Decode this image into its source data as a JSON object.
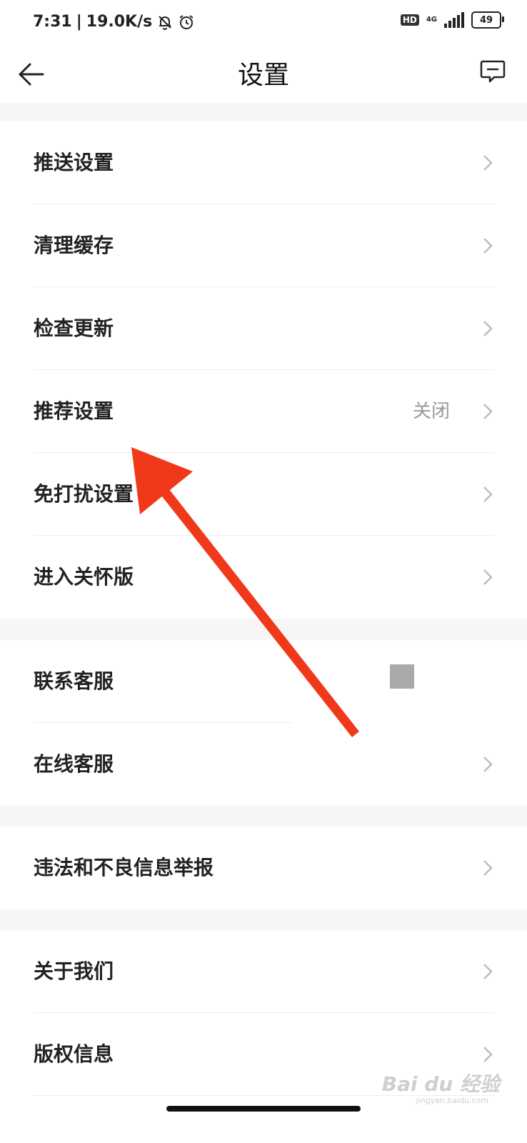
{
  "status": {
    "time": "7:31",
    "speed": "19.0K/s",
    "icons": [
      "bell-mute-icon",
      "alarm-icon"
    ],
    "hd": "HD",
    "network": "4G",
    "battery": "49"
  },
  "header": {
    "title": "设置",
    "back_icon": "arrow-left-icon",
    "feedback_icon": "feedback-icon"
  },
  "groups": [
    {
      "items": [
        {
          "label": "推送设置"
        },
        {
          "label": "清理缓存"
        },
        {
          "label": "检查更新"
        },
        {
          "label": "推荐设置",
          "value": "关闭"
        },
        {
          "label": "免打扰设置"
        },
        {
          "label": "进入关怀版"
        }
      ]
    },
    {
      "items": [
        {
          "label": "联系客服"
        },
        {
          "label": "在线客服"
        }
      ]
    },
    {
      "items": [
        {
          "label": "违法和不良信息举报"
        }
      ]
    },
    {
      "items": [
        {
          "label": "关于我们"
        },
        {
          "label": "版权信息"
        }
      ]
    }
  ],
  "annotation": {
    "arrow_color": "#f0391a"
  },
  "watermark": {
    "brand": "Bai du 经验",
    "url": "jingyan.baidu.com"
  },
  "colors": {
    "background": "#f6f6f6",
    "card": "#ffffff",
    "text": "#222222",
    "secondary": "#999999"
  }
}
